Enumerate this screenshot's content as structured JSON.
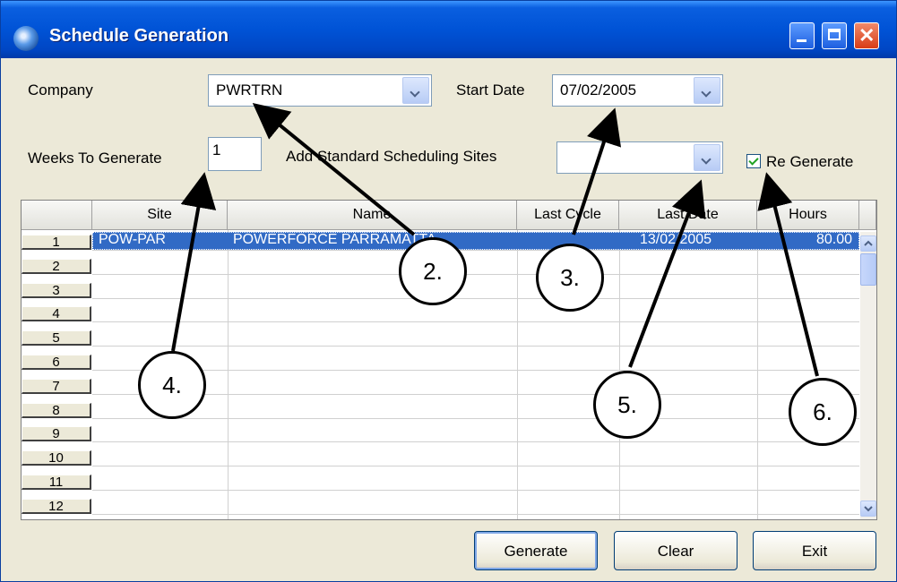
{
  "window": {
    "title": "Schedule Generation"
  },
  "form": {
    "company_label": "Company",
    "company_value": "PWRTRN",
    "start_date_label": "Start Date",
    "start_date_value": "07/02/2005",
    "weeks_label": "Weeks To Generate",
    "weeks_value": "1",
    "add_sites_label": "Add Standard Scheduling Sites",
    "add_sites_value": "",
    "regenerate_label": "Re Generate",
    "regenerate_checked": true
  },
  "grid": {
    "columns": [
      "Site",
      "Name",
      "Last Cycle",
      "Last Date",
      "Hours"
    ],
    "row_numbers": [
      "1",
      "2",
      "3",
      "4",
      "5",
      "6",
      "7",
      "8",
      "9",
      "10",
      "11",
      "12"
    ],
    "rows": [
      {
        "site": "POW-PAR",
        "name": "POWERFORCE PARRAMATTA",
        "last_cycle": "",
        "last_date": "13/02/2005",
        "hours": "80.00"
      }
    ]
  },
  "buttons": {
    "generate": "Generate",
    "clear": "Clear",
    "exit": "Exit"
  },
  "annotations": [
    "2.",
    "3.",
    "4.",
    "5.",
    "6."
  ],
  "icons": [
    "app-icon",
    "minimize-icon",
    "maximize-icon",
    "close-icon",
    "dropdown-arrow-icon",
    "checkbox-checked-icon",
    "scroll-up-icon",
    "scroll-down-icon"
  ]
}
